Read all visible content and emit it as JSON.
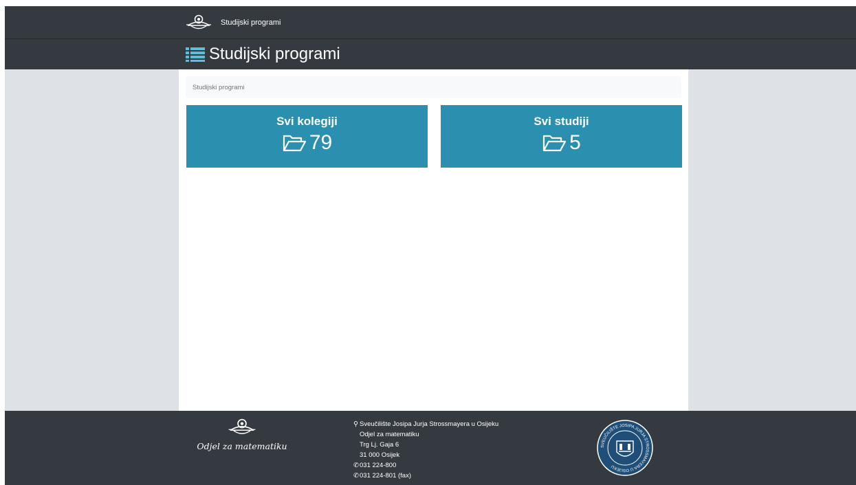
{
  "navbar": {
    "brand": "Studijski programi"
  },
  "header": {
    "title": "Studijski programi",
    "icon": "list-icon"
  },
  "breadcrumb": {
    "current": "Studijski programi"
  },
  "cards": [
    {
      "title": "Svi kolegiji",
      "count": "79",
      "icon": "folder-open-icon"
    },
    {
      "title": "Svi studiji",
      "count": "5",
      "icon": "folder-open-icon"
    }
  ],
  "footer": {
    "department": "Odjel za matematiku",
    "address": {
      "university": "Sveučilište Josipa Jurja Strossmayera u Osijeku",
      "department": "Odjel za matematiku",
      "street": "Trg Lj. Gaja 6",
      "city": "31 000 Osijek",
      "phone": "031 224-800",
      "fax": "031 224-801 (fax)"
    },
    "seal_text": "SVEUČILIŠTE JOSIPA JURJA STROSSMAYERA U OSIJEKU"
  },
  "colors": {
    "navbar_bg": "#343a40",
    "card_bg": "#2b90b0",
    "gutter_bg": "#dee1e6",
    "breadcrumb_bg": "#f8f9fa"
  }
}
